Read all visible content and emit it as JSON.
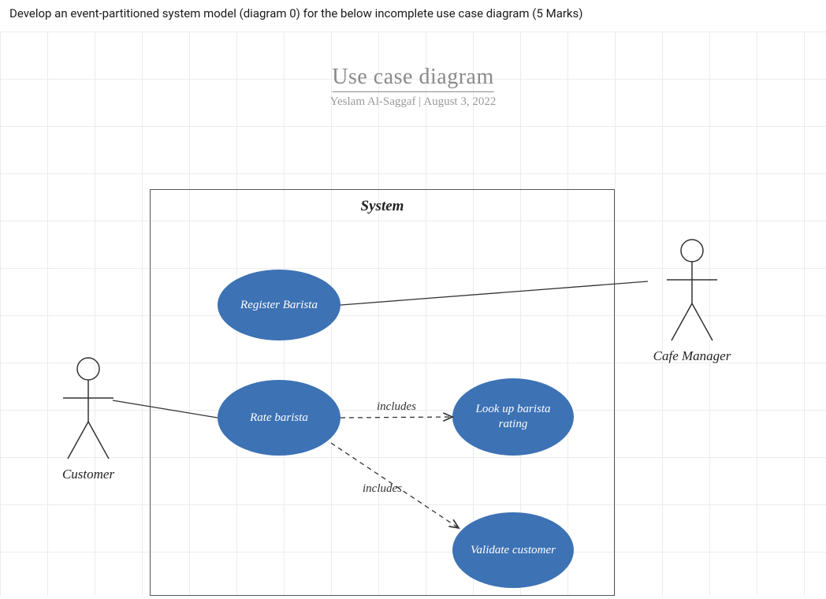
{
  "question": "Develop an event-partitioned system model (diagram 0) for the below incomplete use case diagram (5 Marks)",
  "title": "Use case diagram",
  "author": "Yeslam Al-Saggaf",
  "date": "August 3, 2022",
  "system_label": "System",
  "actors": {
    "customer": "Customer",
    "manager": "Cafe Manager"
  },
  "usecases": {
    "register": "Register Barista",
    "rate": "Rate barista",
    "lookup": "Look up barista rating",
    "validate": "Validate customer"
  },
  "relationships": {
    "includes": "includes"
  },
  "chart_data": {
    "type": "use_case_diagram",
    "title": "Use case diagram",
    "system": "System",
    "actors": [
      "Customer",
      "Cafe Manager"
    ],
    "use_cases": [
      "Register Barista",
      "Rate barista",
      "Look up barista rating",
      "Validate customer"
    ],
    "associations": [
      {
        "actor": "Customer",
        "use_case": "Rate barista"
      },
      {
        "actor": "Cafe Manager",
        "use_case": "Register Barista"
      }
    ],
    "includes": [
      {
        "from": "Rate barista",
        "to": "Look up barista rating"
      },
      {
        "from": "Rate barista",
        "to": "Validate customer"
      }
    ]
  }
}
